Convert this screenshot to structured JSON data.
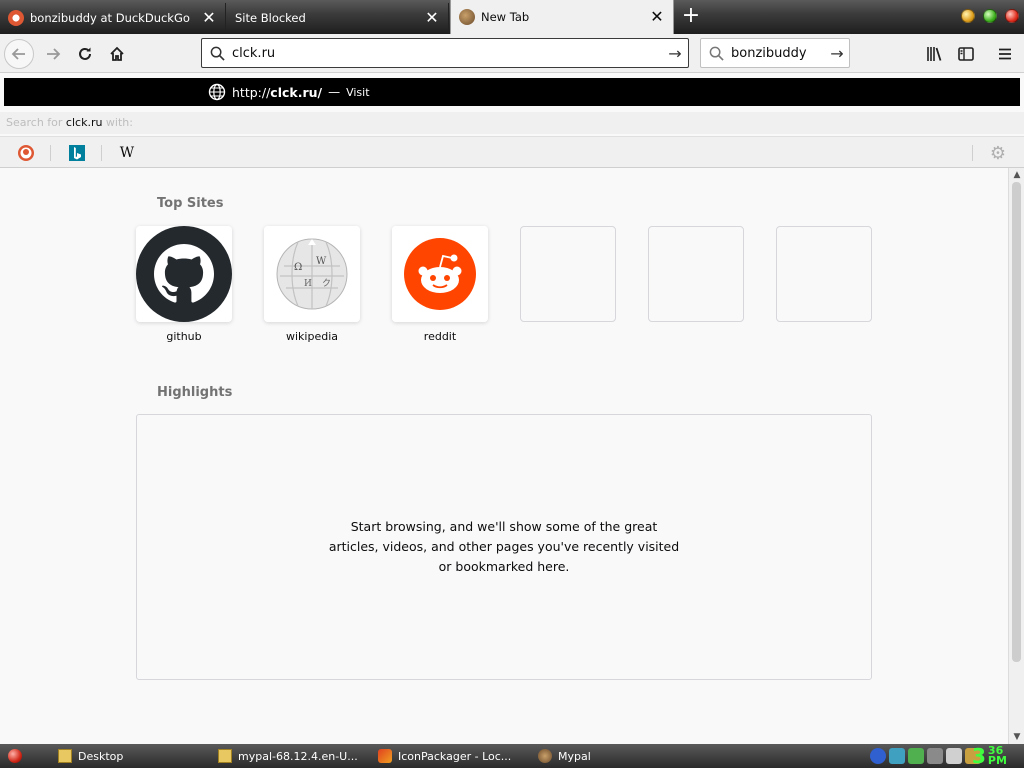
{
  "tabs": [
    {
      "title": "bonzibuddy at DuckDuckGo",
      "favicon": "duckduckgo-icon"
    },
    {
      "title": "Site Blocked",
      "favicon": ""
    },
    {
      "title": "New Tab",
      "favicon": "bonzi-icon",
      "active": true
    }
  ],
  "navbar": {
    "url_value": "clck.ru",
    "search_value": "bonzibuddy"
  },
  "url_popup": {
    "url_prefix": "http://",
    "url_host": "clck.ru/",
    "separator": "—",
    "action": "Visit",
    "search_for_prefix": "Search for ",
    "search_for_term": "clck.ru",
    "search_for_suffix": " with:",
    "engines": [
      "duckduckgo-icon",
      "bing-icon",
      "wikipedia-icon"
    ],
    "engine_wiki_glyph": "W"
  },
  "newtab": {
    "topsites_title": "Top Sites",
    "sites": [
      {
        "label": "github"
      },
      {
        "label": "wikipedia"
      },
      {
        "label": "reddit"
      }
    ],
    "highlights_title": "Highlights",
    "highlights_empty": "Start browsing, and we'll show some of the great articles, videos, and other pages you've recently visited or bookmarked here."
  },
  "taskbar": {
    "tasks": [
      {
        "label": "Desktop"
      },
      {
        "label": "mypal-68.12.4.en-U..."
      },
      {
        "label": "IconPackager - Loc..."
      },
      {
        "label": "Mypal"
      }
    ],
    "clock_hour": "3",
    "clock_minute_top": "36",
    "clock_minute_bottom": "PM"
  },
  "colors": {
    "popup_bg": "#000000",
    "github": "#24292e",
    "reddit": "#ff4500",
    "clock": "#3fff3f"
  }
}
